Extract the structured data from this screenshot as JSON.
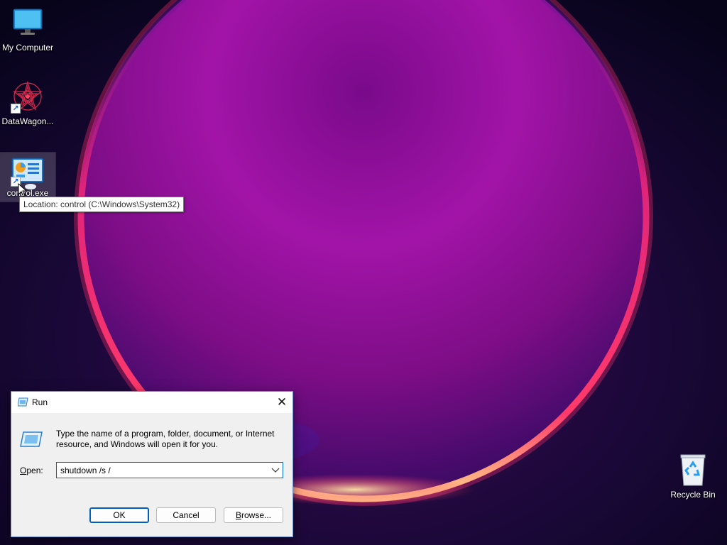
{
  "desktop": {
    "icons": [
      {
        "label": "My Computer",
        "icon": "monitor-icon"
      },
      {
        "label": "DataWagon...",
        "icon": "datawagon-app-icon",
        "shortcut": true
      },
      {
        "label": "control.exe",
        "icon": "control-panel-icon",
        "shortcut": true,
        "selected": true
      },
      {
        "label": "Recycle Bin",
        "icon": "recycle-bin-icon"
      }
    ],
    "tooltip": "Location: control (C:\\Windows\\System32)"
  },
  "run_dialog": {
    "title": "Run",
    "description": "Type the name of a program, folder, document, or Internet resource, and Windows will open it for you.",
    "open_label_prefix": "",
    "open_label_accel": "O",
    "open_label_rest": "pen:",
    "input_value": "shutdown /s /",
    "ok_label": "OK",
    "cancel_label": "Cancel",
    "browse_label_accel": "B",
    "browse_label_rest": "rowse...",
    "close_glyph": "✕"
  },
  "colors": {
    "accent": "#0067c0",
    "dialog_bg": "#f0f0f0"
  }
}
